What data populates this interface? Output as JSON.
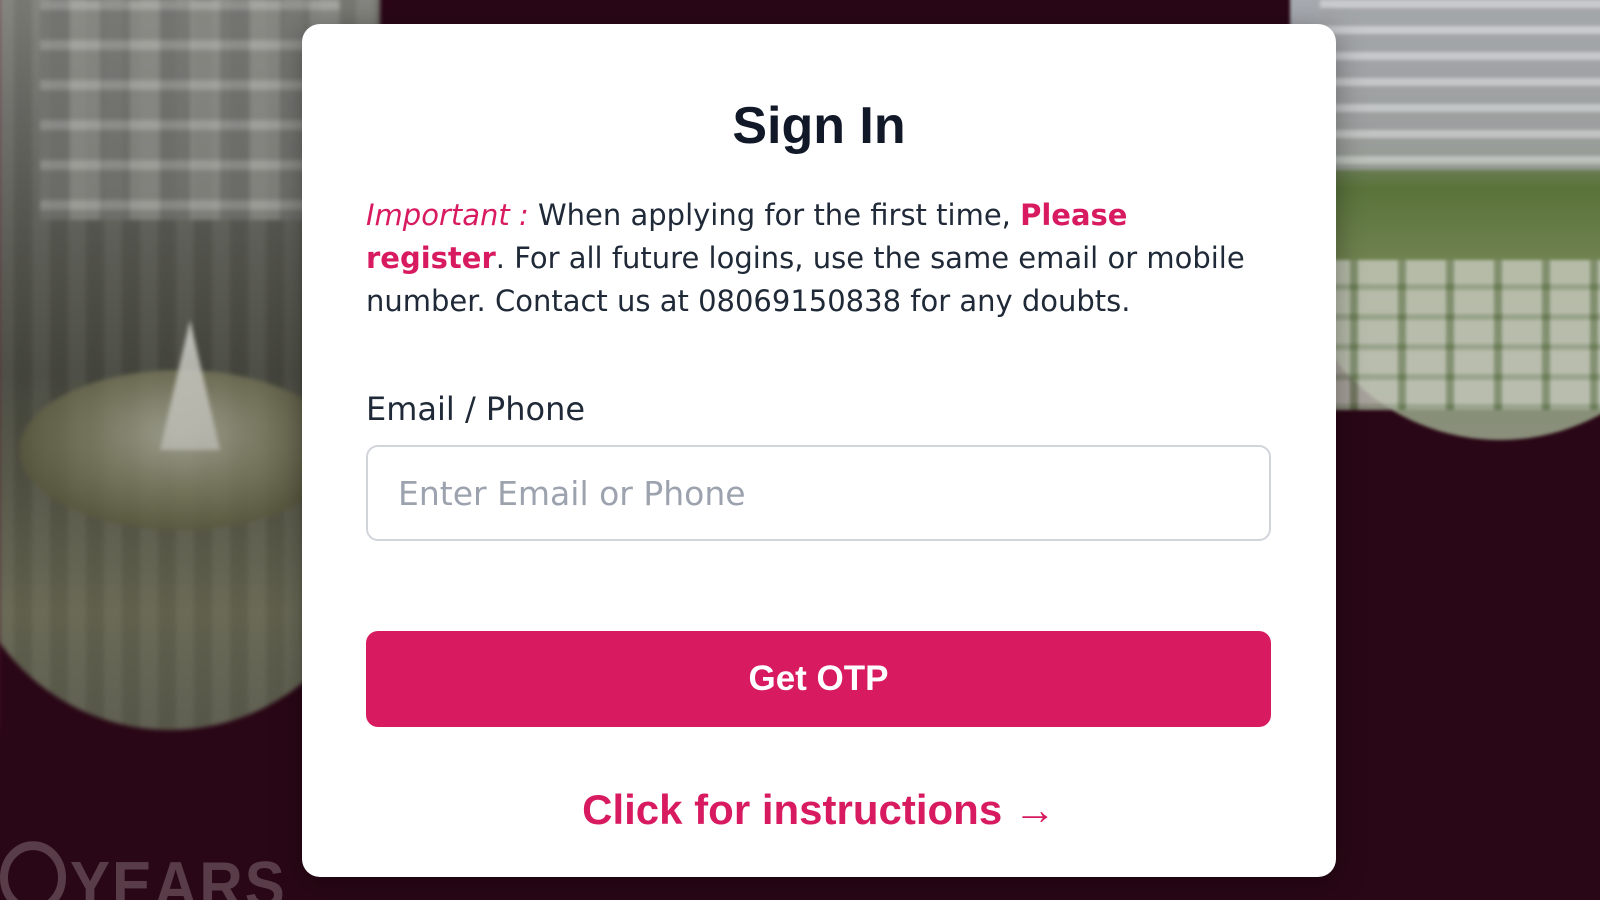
{
  "card": {
    "title": "Sign In",
    "notice": {
      "important_label": "Important :",
      "text_before_link": " When applying for the first time, ",
      "register_link": "Please register",
      "text_after_link": ". For all future logins, use the same email or mobile number. Contact us at 08069150838 for any doubts."
    },
    "field_label": "Email / Phone",
    "input": {
      "value": "",
      "placeholder": "Enter Email or Phone"
    },
    "submit_label": "Get OTP",
    "instructions_link": "Click for instructions →"
  },
  "background": {
    "watermark_text": "YEARS"
  },
  "colors": {
    "accent": "#d81b60",
    "backdrop": "#2a0716",
    "card": "#ffffff",
    "text": "#1f2937"
  }
}
